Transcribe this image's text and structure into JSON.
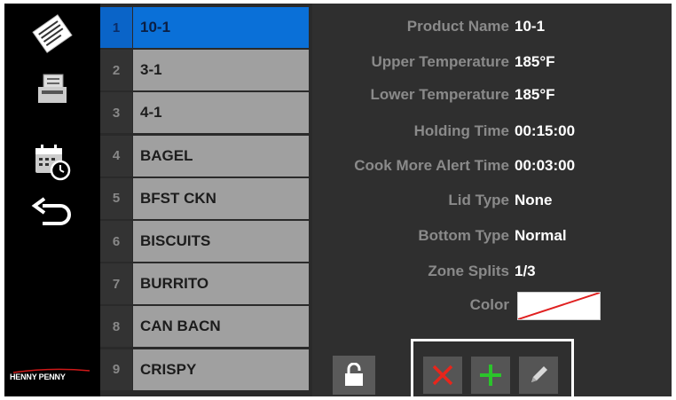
{
  "sidebar": {
    "items": [
      {
        "name": "recipes-icon"
      },
      {
        "name": "printer-icon"
      },
      {
        "name": "calendar-clock-icon"
      },
      {
        "name": "back-arrow-icon"
      }
    ],
    "logo_text": "HENNY PENNY"
  },
  "products": [
    {
      "num": "1",
      "name": "10-1"
    },
    {
      "num": "2",
      "name": "3-1"
    },
    {
      "num": "3",
      "name": "4-1"
    },
    {
      "num": "4",
      "name": "BAGEL"
    },
    {
      "num": "5",
      "name": "BFST CKN"
    },
    {
      "num": "6",
      "name": "BISCUITS"
    },
    {
      "num": "7",
      "name": "BURRITO"
    },
    {
      "num": "8",
      "name": "CAN BACN"
    },
    {
      "num": "9",
      "name": "CRISPY"
    }
  ],
  "selected_index": 0,
  "details": {
    "product_name": {
      "label": "Product Name",
      "value": "10-1"
    },
    "upper_temperature": {
      "label": "Upper Temperature",
      "value": "185°F"
    },
    "lower_temperature": {
      "label": "Lower Temperature",
      "value": "185°F"
    },
    "holding_time": {
      "label": "Holding Time",
      "value": "00:15:00"
    },
    "cook_more_alert_time": {
      "label": "Cook More Alert Time",
      "value": "00:03:00"
    },
    "lid_type": {
      "label": "Lid Type",
      "value": "None"
    },
    "bottom_type": {
      "label": "Bottom Type",
      "value": "Normal"
    },
    "zone_splits": {
      "label": "Zone Splits",
      "value": "1/3"
    },
    "color": {
      "label": "Color"
    }
  },
  "colors": {
    "selected_row": "#0a70d8",
    "delete": "#e8251b",
    "add": "#2bc42b",
    "swatch_strike": "#e02020"
  }
}
